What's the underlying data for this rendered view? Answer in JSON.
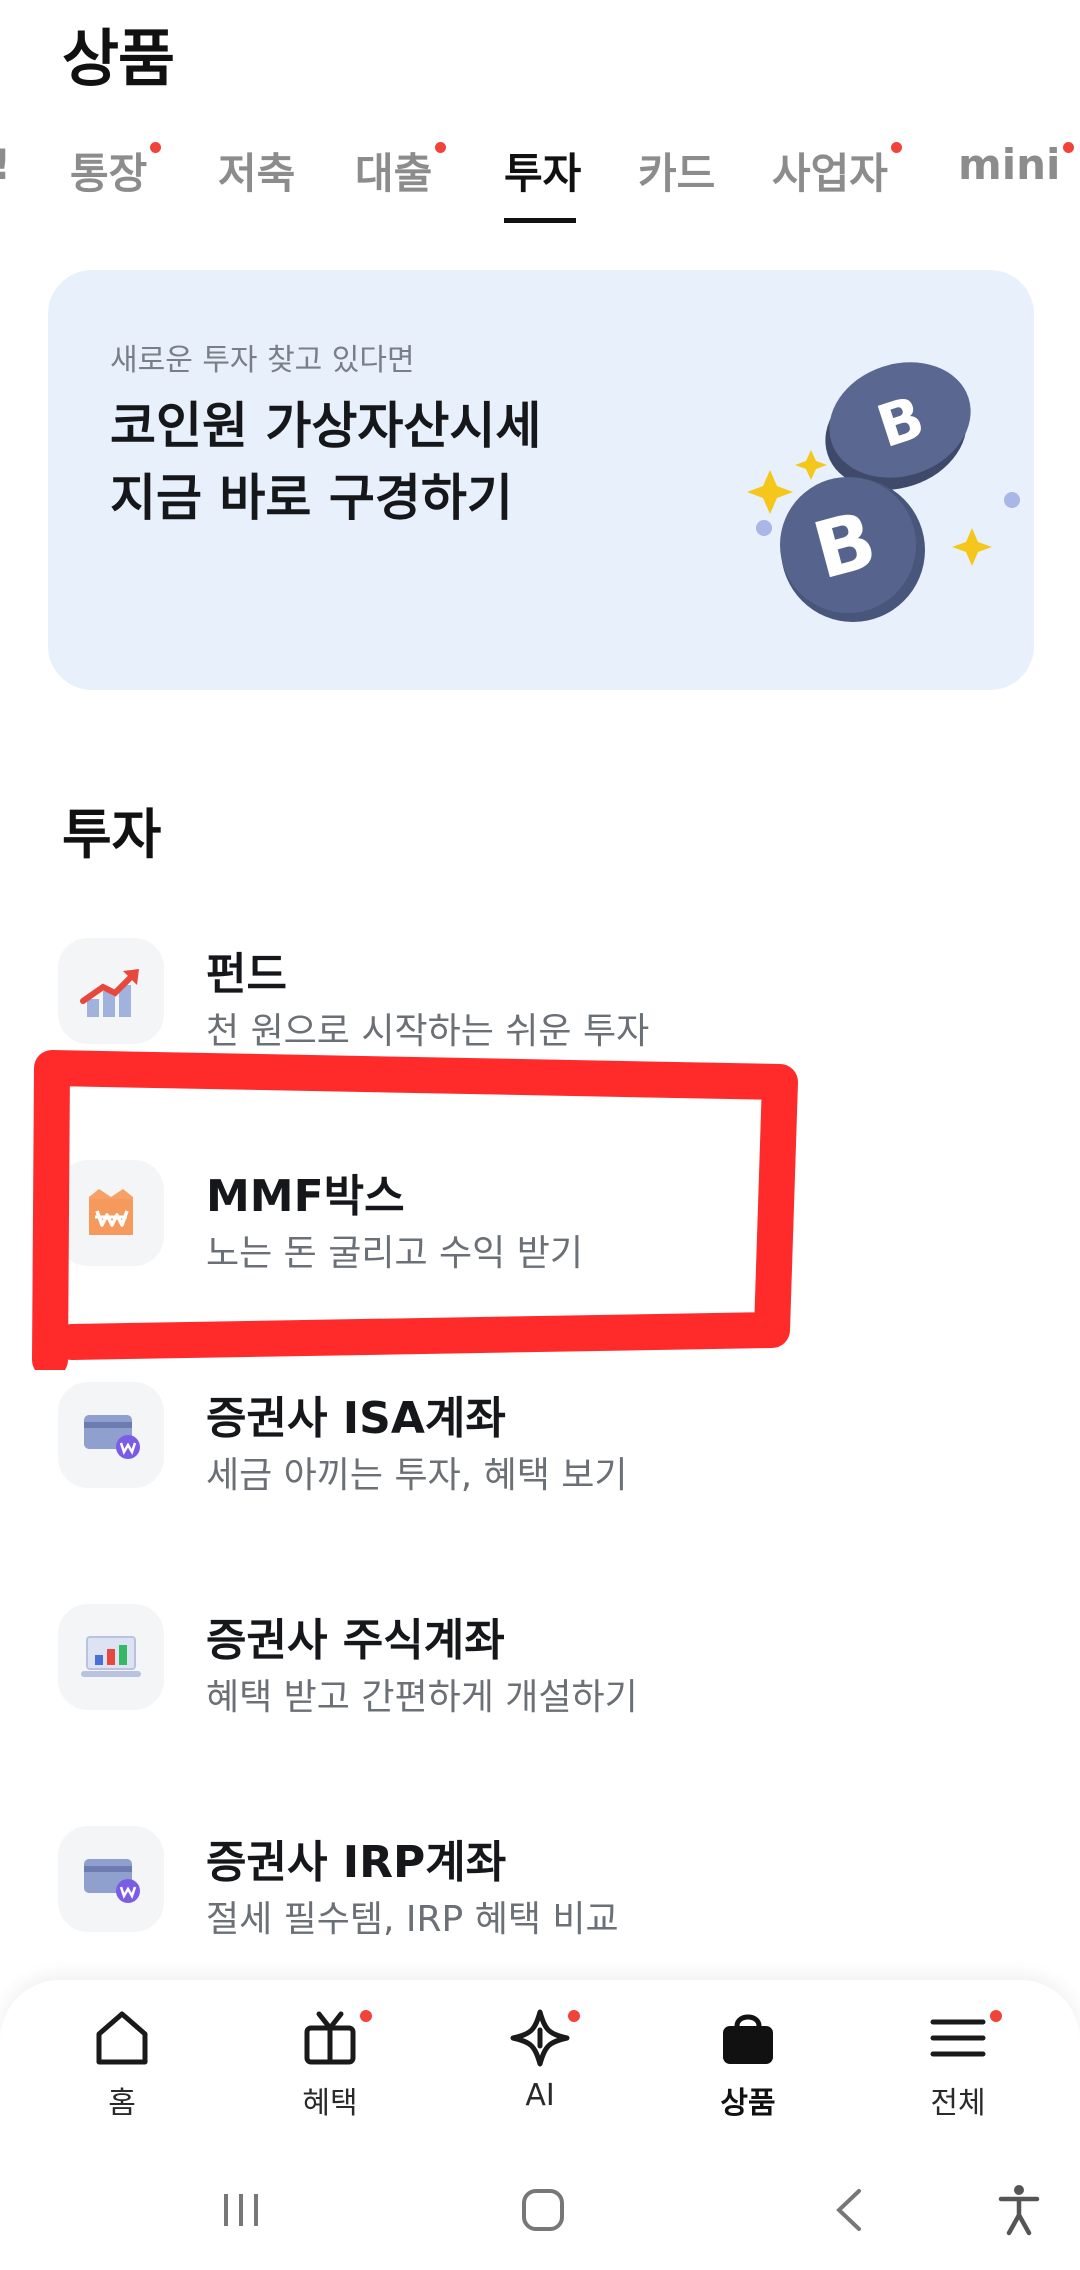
{
  "header": {
    "title": "상품"
  },
  "tabs": [
    {
      "label": "!",
      "dot": false,
      "active": false
    },
    {
      "label": "통장",
      "dot": true,
      "active": false
    },
    {
      "label": "저축",
      "dot": false,
      "active": false
    },
    {
      "label": "대출",
      "dot": true,
      "active": false
    },
    {
      "label": "투자",
      "dot": false,
      "active": true
    },
    {
      "label": "카드",
      "dot": false,
      "active": false
    },
    {
      "label": "사업자",
      "dot": true,
      "active": false
    },
    {
      "label": "mini",
      "dot": true,
      "active": false
    }
  ],
  "banner": {
    "subtitle": "새로운 투자 찾고 있다면",
    "title_line1": "코인원 가상자산시세",
    "title_line2": "지금 바로 구경하기",
    "art": "bitcoin-coins-illustration"
  },
  "section": {
    "title": "투자"
  },
  "items": [
    {
      "title": "펀드",
      "desc": "천 원으로 시작하는 쉬운 투자",
      "icon": "chart-up-icon"
    },
    {
      "title": "MMF박스",
      "desc": "노는 돈 굴리고 수익 받기",
      "icon": "won-box-icon"
    },
    {
      "title": "증권사 ISA계좌",
      "desc": "세금 아끼는 투자, 혜택 보기",
      "icon": "card-won-icon"
    },
    {
      "title": "증권사 주식계좌",
      "desc": "혜택 받고 간편하게 개설하기",
      "icon": "laptop-chart-icon"
    },
    {
      "title": "증권사 IRP계좌",
      "desc": "절세 필수템, IRP 혜택 비교",
      "icon": "card-won-icon"
    }
  ],
  "bottom_nav": [
    {
      "label": "홈",
      "icon": "home-icon",
      "active": false,
      "dot": false
    },
    {
      "label": "혜택",
      "icon": "gift-icon",
      "active": false,
      "dot": true
    },
    {
      "label": "AI",
      "icon": "ai-diamond-icon",
      "active": false,
      "dot": true
    },
    {
      "label": "상품",
      "icon": "shopping-bag-icon",
      "active": true,
      "dot": false
    },
    {
      "label": "전체",
      "icon": "menu-icon",
      "active": false,
      "dot": true
    }
  ],
  "colors": {
    "accent_dot": "#f2433b",
    "banner_bg": "#e8f0fc",
    "annotation": "#ff2b2b"
  }
}
